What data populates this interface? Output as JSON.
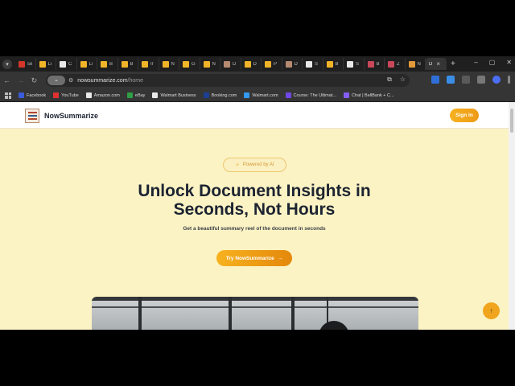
{
  "browser": {
    "tabs": [
      {
        "label": "se",
        "color": "#d4362a"
      },
      {
        "label": "Li",
        "color": "#f0b429"
      },
      {
        "label": "C",
        "color": "#e8e8e8"
      },
      {
        "label": "Li",
        "color": "#f0b429"
      },
      {
        "label": "B",
        "color": "#f0b429"
      },
      {
        "label": "B",
        "color": "#f0b429"
      },
      {
        "label": "Ir",
        "color": "#f0b429"
      },
      {
        "label": "N",
        "color": "#f0b429"
      },
      {
        "label": "G",
        "color": "#f0b429"
      },
      {
        "label": "N",
        "color": "#f0b429"
      },
      {
        "label": "D",
        "color": "#b58a70"
      },
      {
        "label": "D",
        "color": "#f0b429"
      },
      {
        "label": "P",
        "color": "#f0b429"
      },
      {
        "label": "D",
        "color": "#b58a70"
      },
      {
        "label": "S",
        "color": "#e8e8e8"
      },
      {
        "label": "B",
        "color": "#f0b429"
      },
      {
        "label": "S",
        "color": "#e8e8e8"
      },
      {
        "label": "B",
        "color": "#c9475a"
      },
      {
        "label": "Z",
        "color": "#c9475a"
      },
      {
        "label": "N",
        "color": "#e39a3a"
      }
    ],
    "active_tab": {
      "label": "D",
      "close": "×"
    },
    "new_tab": "+",
    "window_controls": {
      "minimize": "–",
      "maximize": "▢",
      "close": "✕"
    },
    "url_host": "nowsummarize.com",
    "url_path": "/home",
    "bookmarks": [
      {
        "label": "Facebook",
        "color": "#3b5bdb"
      },
      {
        "label": "YouTube",
        "color": "#e03131"
      },
      {
        "label": "Amazon.com",
        "color": "#e8e8e8"
      },
      {
        "label": "eBay",
        "color": "#2f9e44"
      },
      {
        "label": "Walmart Business",
        "color": "#e8e8e8"
      },
      {
        "label": "Booking.com",
        "color": "#1c3f94"
      },
      {
        "label": "Walmart.com",
        "color": "#339af0"
      },
      {
        "label": "Course: The Ultimat...",
        "color": "#7048e8"
      },
      {
        "label": "Chat | BellBank + C...",
        "color": "#845ef7"
      }
    ]
  },
  "site": {
    "brand": "NowSummarize",
    "signin_label": "Sign In",
    "badge_text": "Powered by AI",
    "hero_title_line1": "Unlock Document Insights in",
    "hero_title_line2": "Seconds, Not Hours",
    "hero_subtitle": "Get a beautiful summary reel of the document in seconds",
    "cta_label": "Try NowSummarize",
    "cta_arrow": "→",
    "scroll_top": "↑"
  },
  "colors": {
    "page_bg": "#fcf3c4",
    "accent": "#f2a51e",
    "heading": "#1c2331"
  }
}
